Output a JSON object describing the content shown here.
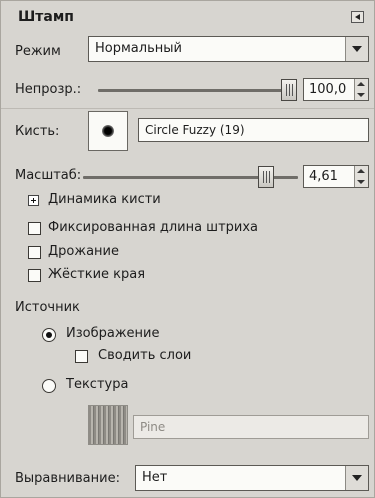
{
  "panel": {
    "title": "Штамп",
    "mode": {
      "label": "Режим",
      "value": "Нормальный"
    },
    "opacity": {
      "label": "Непрозр.:",
      "value": "100,0"
    },
    "brush": {
      "label": "Кисть:",
      "value": "Circle Fuzzy (19)"
    },
    "scale": {
      "label": "Масштаб:",
      "value": "4,61"
    },
    "dynamics": {
      "label": "Динамика кисти"
    },
    "checks": [
      {
        "label": "Фиксированная длина штриха",
        "checked": false
      },
      {
        "label": "Дрожание",
        "checked": false
      },
      {
        "label": "Жёсткие края",
        "checked": false
      }
    ],
    "source": {
      "label": "Источник",
      "image": {
        "label": "Изображение",
        "selected": true
      },
      "merge_layers": {
        "label": "Сводить слои",
        "checked": false
      },
      "pattern": {
        "label": "Текстура",
        "selected": false
      },
      "pattern_name": "Pine"
    },
    "alignment": {
      "label": "Выравнивание:",
      "value": "Нет"
    }
  },
  "colors": {
    "background": "#d7d5d0",
    "text": "#1d1d1d"
  },
  "icons": {
    "menu": "panel-menu-icon",
    "expander": "expander-plus-icon"
  }
}
